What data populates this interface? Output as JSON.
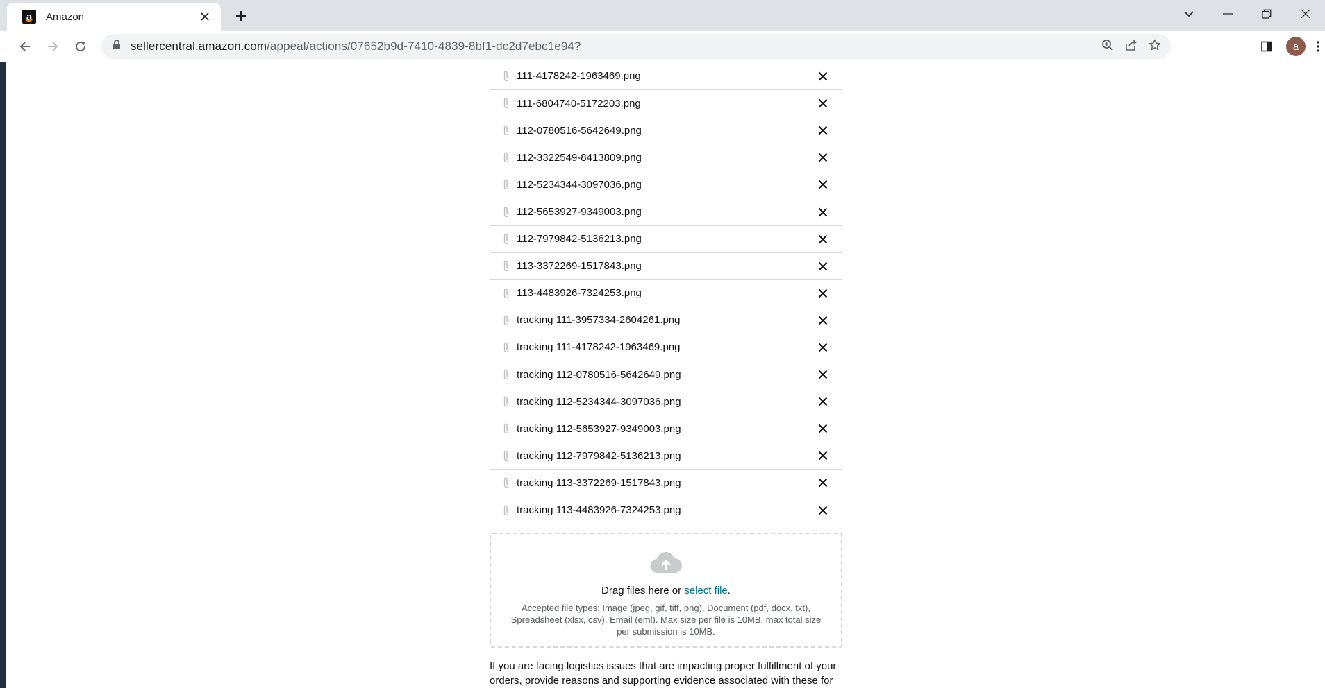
{
  "browser": {
    "tab_title": "Amazon",
    "favicon_letter": "a",
    "url_domain": "sellercentral.amazon.com",
    "url_path": "/appeal/actions/07652b9d-7410-4839-8bf1-dc2d7ebc1e94?",
    "profile_initial": "a"
  },
  "files": [
    "111-4178242-1963469.png",
    "111-6804740-5172203.png",
    "112-0780516-5642649.png",
    "112-3322549-8413809.png",
    "112-5234344-3097036.png",
    "112-5653927-9349003.png",
    "112-7979842-5136213.png",
    "113-3372269-1517843.png",
    "113-4483926-7324253.png",
    "tracking 111-3957334-2604261.png",
    "tracking 111-4178242-1963469.png",
    "tracking 112-0780516-5642649.png",
    "tracking 112-5234344-3097036.png",
    "tracking 112-5653927-9349003.png",
    "tracking 112-7979842-5136213.png",
    "tracking 113-3372269-1517843.png",
    "tracking 113-4483926-7324253.png"
  ],
  "dropzone": {
    "prefix": "Drag files here or ",
    "link": "select file",
    "suffix": ".",
    "hint": "Accepted file types: Image (jpeg, gif, tiff, png), Document (pdf, docx, txt), Spreadsheet (xlsx, csv), Email (eml). Max size per file is 10MB, max total size per submission is 10MB."
  },
  "info_text": "If you are facing logistics issues that are impacting proper fulfillment of your orders, provide reasons and supporting evidence associated with these for consideration during your review.",
  "colors": {
    "link": "#007185",
    "tab_strip": "#dee1e6",
    "border": "#d5d9d9"
  }
}
